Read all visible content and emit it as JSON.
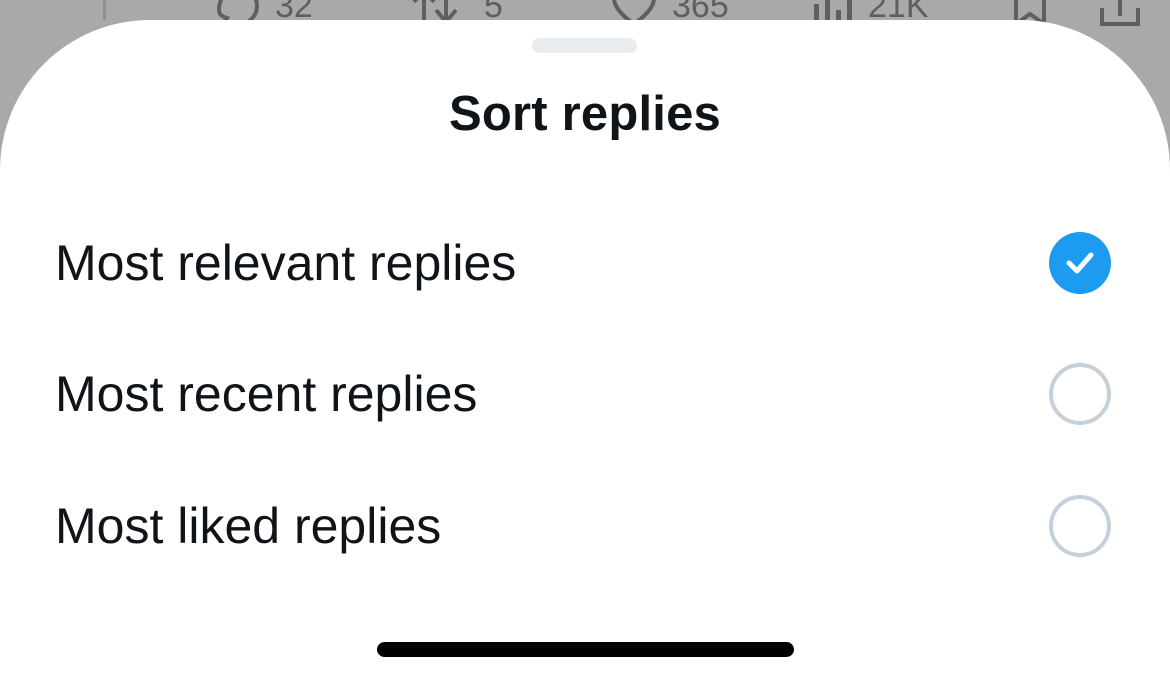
{
  "background_tweet": {
    "actions": [
      {
        "icon": "reply-icon",
        "count": "32"
      },
      {
        "icon": "retweet-icon",
        "count": "5"
      },
      {
        "icon": "like-icon",
        "count": "365"
      },
      {
        "icon": "views-icon",
        "count": "21K"
      },
      {
        "icon": "bookmark-icon",
        "count": ""
      },
      {
        "icon": "share-icon",
        "count": ""
      }
    ]
  },
  "sheet": {
    "title": "Sort replies",
    "options": [
      {
        "label": "Most relevant replies",
        "selected": true
      },
      {
        "label": "Most recent replies",
        "selected": false
      },
      {
        "label": "Most liked replies",
        "selected": false
      }
    ]
  },
  "colors": {
    "accent": "#1d9bf0",
    "text": "#0f1419",
    "radio_border": "#c5d0d8",
    "overlay": "#a9a9a9"
  }
}
